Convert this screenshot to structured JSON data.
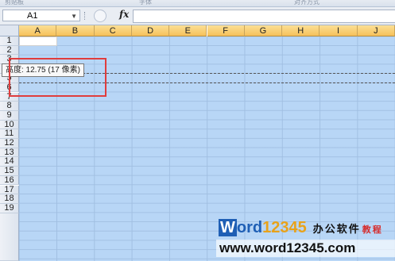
{
  "ribbon": {
    "labels": [
      "剪贴板",
      "字体",
      "对齐方式"
    ]
  },
  "formula_bar": {
    "name_box": "A1",
    "fx_label": "fx",
    "formula": ""
  },
  "columns": [
    "A",
    "B",
    "C",
    "D",
    "E",
    "F",
    "G",
    "H",
    "I",
    "J"
  ],
  "rows": [
    "1",
    "2",
    "3",
    "4",
    "5",
    "6",
    "7",
    "8",
    "9",
    "10",
    "11",
    "12",
    "13",
    "14",
    "15",
    "16",
    "17",
    "18",
    "19"
  ],
  "tooltip": {
    "text": "高度: 12.75 (17 像素)"
  },
  "watermark": {
    "w": "W",
    "ord": "ord",
    "num": "12345",
    "cn1": "办公软件",
    "cn2": "教程",
    "url": "www.word12345.com"
  },
  "colors": {
    "selection": "#b8d6f6",
    "column_header_selected": "#f6c15b",
    "highlight_box": "#e03d3d"
  }
}
